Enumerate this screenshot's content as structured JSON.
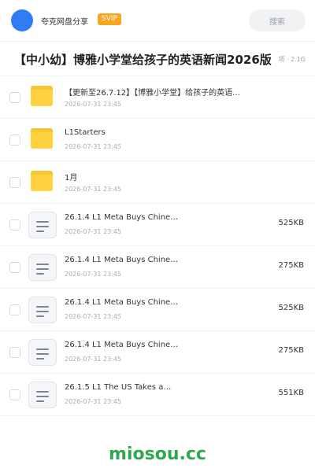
{
  "header": {
    "app_name": "夸克网盘分享",
    "badge": "SVIP",
    "search_label": "搜索"
  },
  "title": "【中小幼】博雅小学堂给孩子的英语新闻2026版",
  "meta": "项 · 2.1G",
  "items": [
    {
      "type": "folder",
      "name": "【更新至26.7.12】【博雅小学堂】给孩子的英语…",
      "date": "2026-07-31 23:45",
      "size": ""
    },
    {
      "type": "folder",
      "name": "L1Starters",
      "date": "2026-07-31 23:45",
      "size": ""
    },
    {
      "type": "folder",
      "name": "1月",
      "date": "2026-07-31 23:45",
      "size": ""
    },
    {
      "type": "file",
      "name": "26.1.4 L1 Meta Buys Chine…",
      "date": "2026-07-31 23:45",
      "size": "525KB"
    },
    {
      "type": "file",
      "name": "26.1.4 L1 Meta Buys Chine…",
      "date": "2026-07-31 23:45",
      "size": "275KB"
    },
    {
      "type": "file",
      "name": "26.1.4 L1 Meta Buys Chine…",
      "date": "2026-07-31 23:45",
      "size": "525KB"
    },
    {
      "type": "file",
      "name": "26.1.4 L1 Meta Buys Chine…",
      "date": "2026-07-31 23:45",
      "size": "275KB"
    },
    {
      "type": "file",
      "name": "26.1.5  L1 The US Takes a…",
      "date": "2026-07-31 23:45",
      "size": "551KB"
    }
  ],
  "watermark": "miosou.cc",
  "colors": {
    "avatar": "#2f7cf6",
    "svip": "#f6a623",
    "folder": "#ffd23f",
    "watermark": "#2fa84f"
  }
}
